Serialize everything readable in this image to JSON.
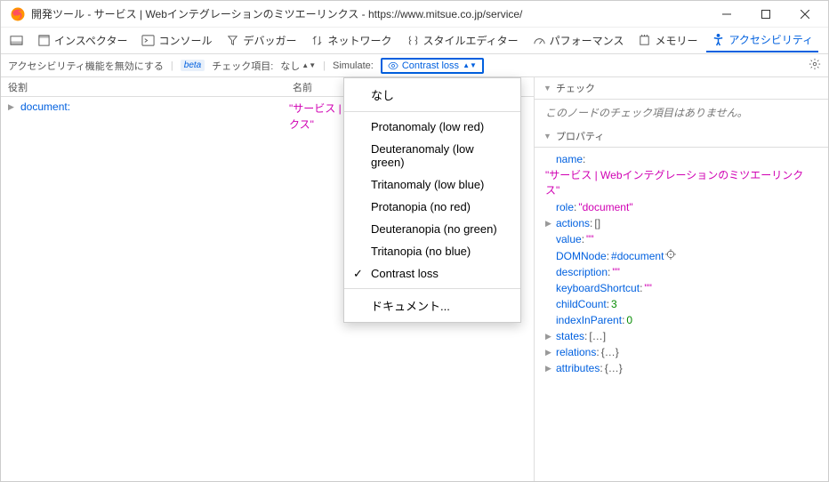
{
  "window": {
    "title": "開発ツール - サービス | Webインテグレーションのミツエーリンクス - https://www.mitsue.co.jp/service/"
  },
  "toolbar": {
    "inspector": "インスペクター",
    "console": "コンソール",
    "debugger": "デバッガー",
    "network": "ネットワーク",
    "style": "スタイルエディター",
    "perf": "パフォーマンス",
    "memory": "メモリー",
    "a11y": "アクセシビリティ"
  },
  "subbar": {
    "disable": "アクセシビリティ機能を無効にする",
    "beta": "beta",
    "check_label": "チェック項目:",
    "check_value": "なし",
    "simulate": "Simulate:",
    "sim_value": "Contrast loss"
  },
  "tree": {
    "col_role": "役割",
    "col_name": "名前",
    "doc_role": "document:",
    "doc_name_l1": "\"サービス | Webインテグレーション",
    "doc_name_l2": "クス\""
  },
  "dropdown": {
    "none": "なし",
    "protanomaly": "Protanomaly (low red)",
    "deuteranomaly": "Deuteranomaly (low green)",
    "tritanomaly": "Tritanomaly (low blue)",
    "protanopia": "Protanopia (no red)",
    "deuteranopia": "Deuteranopia (no green)",
    "tritanopia": "Tritanopia (no blue)",
    "contrast": "Contrast loss",
    "doc": "ドキュメント..."
  },
  "right": {
    "check_head": "チェック",
    "no_check": "このノードのチェック項目はありません。",
    "props_head": "プロパティ",
    "name_k": "name",
    "name_v": "\"サービス | Webインテグレーションのミツエーリンクス\"",
    "role_k": "role",
    "role_v": "\"document\"",
    "actions_k": "actions",
    "actions_v": "[]",
    "value_k": "value",
    "value_v": "\"\"",
    "dom_k": "DOMNode",
    "dom_v": "#document",
    "desc_k": "description",
    "desc_v": "\"\"",
    "kbd_k": "keyboardShortcut",
    "kbd_v": "\"\"",
    "childcount_k": "childCount",
    "childcount_v": "3",
    "idx_k": "indexInParent",
    "idx_v": "0",
    "states_k": "states",
    "states_v": "[…]",
    "relations_k": "relations",
    "relations_v": "{…}",
    "attrs_k": "attributes",
    "attrs_v": "{…}"
  }
}
